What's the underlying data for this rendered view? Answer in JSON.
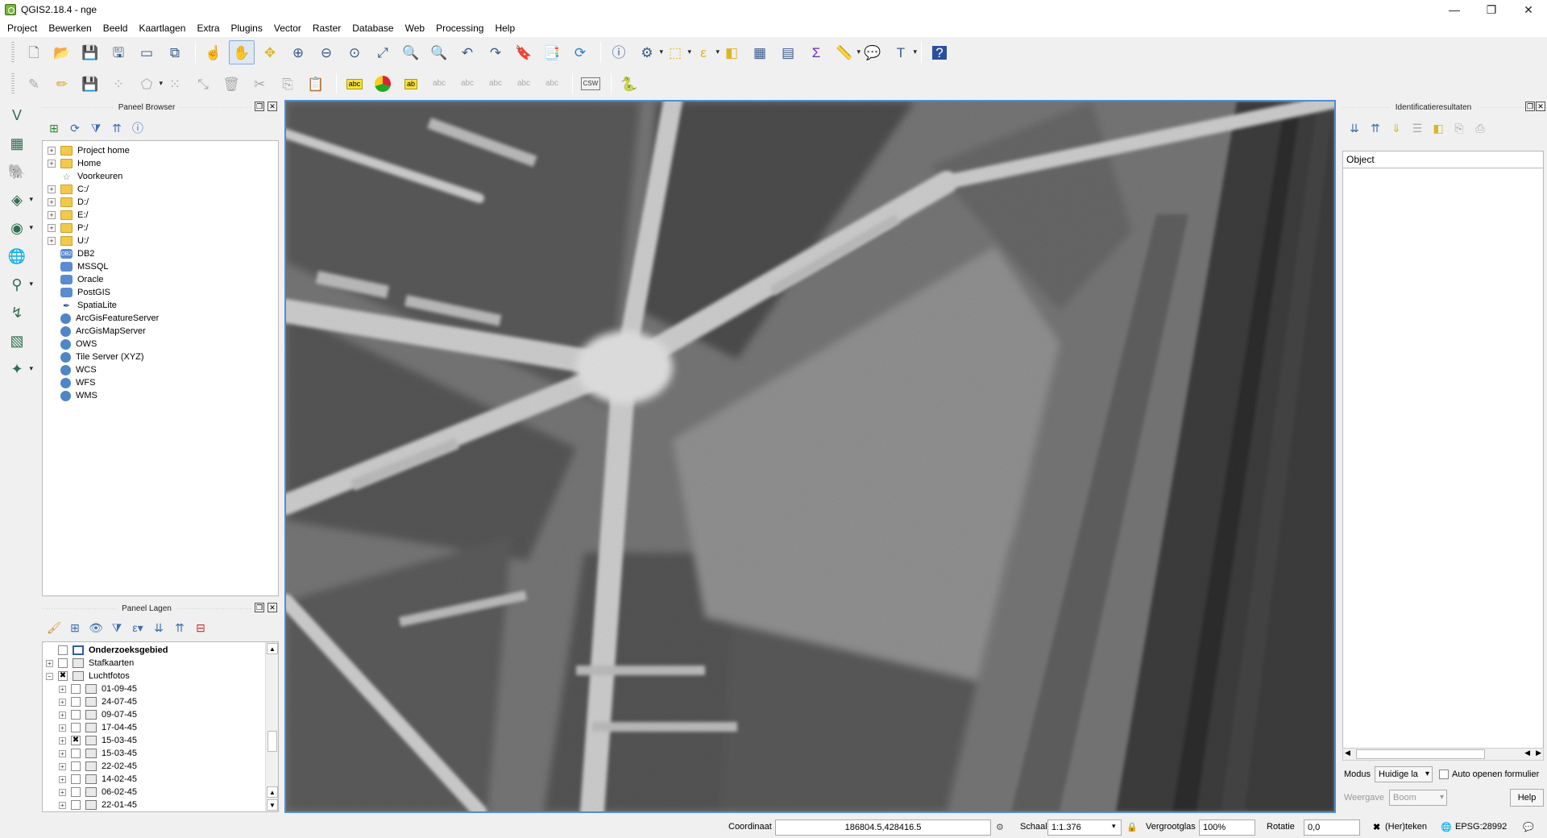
{
  "window": {
    "title": "QGIS2.18.4 - nge",
    "controls": [
      "—",
      "❐",
      "✕"
    ]
  },
  "menu": [
    "Project",
    "Bewerken",
    "Beeld",
    "Kaartlagen",
    "Extra",
    "Plugins",
    "Vector",
    "Raster",
    "Database",
    "Web",
    "Processing",
    "Help"
  ],
  "toolbar1": {
    "icons": [
      "new-project-icon",
      "open-project-icon",
      "save-project-icon",
      "save-as-icon",
      "print-composer-icon",
      "composer-manager-icon",
      "touch-zoom-icon",
      "pan-icon",
      "pan-to-selection-icon",
      "zoom-in-icon",
      "zoom-out-icon",
      "zoom-native-icon",
      "zoom-full-icon",
      "zoom-to-selection-icon",
      "zoom-to-layer-icon",
      "zoom-last-icon",
      "zoom-next-icon",
      "new-bookmark-icon",
      "show-bookmarks-icon",
      "refresh-icon",
      "identify-icon",
      "select-icon",
      "select-rect-icon",
      "select-value-icon",
      "deselect-icon",
      "attribute-table-icon",
      "field-calc-icon",
      "statistics-icon",
      "measure-icon",
      "map-tips-icon",
      "text-annotation-icon",
      "help-icon"
    ]
  },
  "toolbar2": {
    "icons": [
      "edit-pencil-icon",
      "toggle-edit-icon",
      "save-edits-icon",
      "add-feature-icon",
      "move-feature-icon",
      "node-tool-icon",
      "delete-selected-icon",
      "cut-features-icon",
      "copy-features-icon",
      "paste-features-icon",
      "label-abc-icon",
      "diagram-icon",
      "label-highlight-icon",
      "pin-label-icon",
      "show-hide-labels-icon",
      "move-label-icon",
      "rotate-label-icon",
      "change-label-icon",
      "csw-icon",
      "python-icon"
    ],
    "csw_label": "CSW",
    "abc_label": "abc"
  },
  "browser_panel": {
    "title": "Paneel Browser",
    "items": [
      {
        "label": "Project home",
        "icon": "folder-icon",
        "expandable": true
      },
      {
        "label": "Home",
        "icon": "folder-icon",
        "expandable": true
      },
      {
        "label": "Voorkeuren",
        "icon": "star-icon",
        "expandable": false
      },
      {
        "label": "C:/",
        "icon": "folder-icon",
        "expandable": true
      },
      {
        "label": "D:/",
        "icon": "folder-icon",
        "expandable": true
      },
      {
        "label": "E:/",
        "icon": "folder-icon",
        "expandable": true
      },
      {
        "label": "P:/",
        "icon": "folder-icon",
        "expandable": true
      },
      {
        "label": "U:/",
        "icon": "folder-icon",
        "expandable": true
      },
      {
        "label": "DB2",
        "icon": "db2-icon",
        "expandable": false
      },
      {
        "label": "MSSQL",
        "icon": "mssql-icon",
        "expandable": false
      },
      {
        "label": "Oracle",
        "icon": "oracle-icon",
        "expandable": false
      },
      {
        "label": "PostGIS",
        "icon": "postgis-icon",
        "expandable": false
      },
      {
        "label": "SpatiaLite",
        "icon": "spatialite-icon",
        "expandable": false
      },
      {
        "label": "ArcGisFeatureServer",
        "icon": "globe-icon",
        "expandable": false
      },
      {
        "label": "ArcGisMapServer",
        "icon": "globe-icon",
        "expandable": false
      },
      {
        "label": "OWS",
        "icon": "globe-icon",
        "expandable": false
      },
      {
        "label": "Tile Server (XYZ)",
        "icon": "globe-icon",
        "expandable": false
      },
      {
        "label": "WCS",
        "icon": "globe-icon",
        "expandable": false
      },
      {
        "label": "WFS",
        "icon": "globe-icon",
        "expandable": false
      },
      {
        "label": "WMS",
        "icon": "globe-icon",
        "expandable": false
      }
    ],
    "db2_text": "DB2"
  },
  "layers_panel": {
    "title": "Paneel Lagen",
    "layers": [
      {
        "label": "Onderzoeksgebied",
        "level": 0,
        "bold": true,
        "checked": false,
        "expander": "",
        "type": "polygon"
      },
      {
        "label": "Stafkaarten",
        "level": 0,
        "bold": false,
        "checked": false,
        "expander": "+",
        "type": "group"
      },
      {
        "label": "Luchtfotos",
        "level": 0,
        "bold": false,
        "checked": true,
        "expander": "−",
        "type": "group"
      },
      {
        "label": "01-09-45",
        "level": 1,
        "bold": false,
        "checked": false,
        "expander": "+",
        "type": "raster"
      },
      {
        "label": "24-07-45",
        "level": 1,
        "bold": false,
        "checked": false,
        "expander": "+",
        "type": "raster"
      },
      {
        "label": "09-07-45",
        "level": 1,
        "bold": false,
        "checked": false,
        "expander": "+",
        "type": "raster"
      },
      {
        "label": "17-04-45",
        "level": 1,
        "bold": false,
        "checked": false,
        "expander": "+",
        "type": "raster"
      },
      {
        "label": "15-03-45",
        "level": 1,
        "bold": false,
        "checked": true,
        "expander": "+",
        "type": "raster"
      },
      {
        "label": "15-03-45",
        "level": 1,
        "bold": false,
        "checked": false,
        "expander": "+",
        "type": "raster"
      },
      {
        "label": "22-02-45",
        "level": 1,
        "bold": false,
        "checked": false,
        "expander": "+",
        "type": "raster"
      },
      {
        "label": "14-02-45",
        "level": 1,
        "bold": false,
        "checked": false,
        "expander": "+",
        "type": "raster"
      },
      {
        "label": "06-02-45",
        "level": 1,
        "bold": false,
        "checked": false,
        "expander": "+",
        "type": "raster"
      },
      {
        "label": "22-01-45",
        "level": 1,
        "bold": false,
        "checked": false,
        "expander": "+",
        "type": "raster"
      }
    ]
  },
  "identify_panel": {
    "title": "Identificatieresultaten",
    "column_header": "Object",
    "mode_label": "Modus",
    "mode_value": "Huidige la",
    "auto_open_label": "Auto openen formulier",
    "view_label": "Weergave",
    "view_value": "Boom",
    "help_label": "Help"
  },
  "statusbar": {
    "coordinate_label": "Coordinaat",
    "coordinate_value": "186804.5,428416.5",
    "scale_label": "Schaal",
    "scale_value": "1:1.376",
    "magnifier_label": "Vergrootglas",
    "magnifier_value": "100%",
    "rotation_label": "Rotatie",
    "rotation_value": "0,0",
    "render_label": "(Her)teken",
    "crs_label": "EPSG:28992"
  }
}
